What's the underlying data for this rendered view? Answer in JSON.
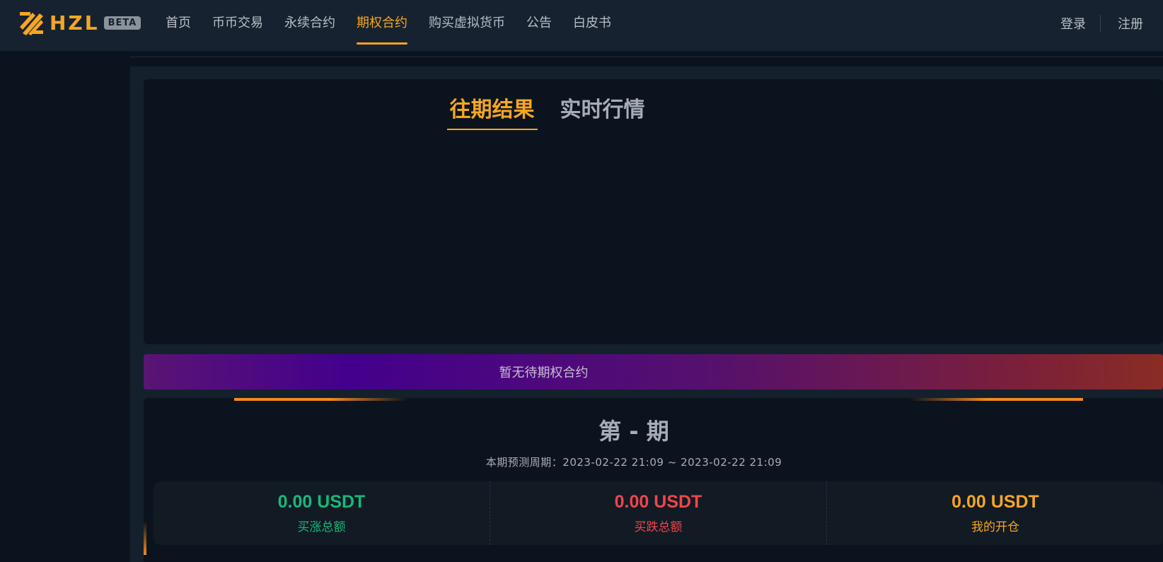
{
  "brand": {
    "name": "HZL",
    "badge": "BETA",
    "accent": "#f5a623"
  },
  "nav": {
    "items": [
      {
        "label": "首页",
        "active": false
      },
      {
        "label": "币币交易",
        "active": false
      },
      {
        "label": "永续合约",
        "active": false
      },
      {
        "label": "期权合约",
        "active": true
      },
      {
        "label": "购买虚拟货币",
        "active": false
      },
      {
        "label": "公告",
        "active": false
      },
      {
        "label": "白皮书",
        "active": false
      }
    ]
  },
  "auth": {
    "login": "登录",
    "register": "注册"
  },
  "tabs": [
    {
      "label": "往期结果",
      "active": true
    },
    {
      "label": "实时行情",
      "active": false
    }
  ],
  "banner": {
    "text": "暂无待期权合约"
  },
  "period": {
    "title": "第 - 期",
    "range_label": "本期预测周期：",
    "range_start": "2023-02-22 21:09",
    "range_sep": " ~ ",
    "range_end": "2023-02-22 21:09"
  },
  "stats": [
    {
      "value": "0.00 USDT",
      "label": "买涨总额",
      "color": "#16b979"
    },
    {
      "value": "0.00 USDT",
      "label": "买跌总额",
      "color": "#f0454c"
    },
    {
      "value": "0.00 USDT",
      "label": "我的开仓",
      "color": "#f5a623"
    }
  ]
}
